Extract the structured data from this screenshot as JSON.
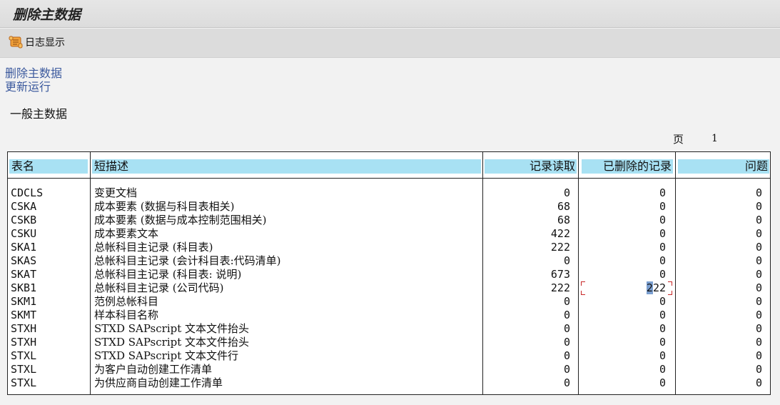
{
  "title": "删除主数据",
  "toolbar": {
    "log_button": "日志显示",
    "log_icon": "scroll-log-icon"
  },
  "links": {
    "delete": "删除主数据",
    "update": "更新运行"
  },
  "section_title": "一般主数据",
  "page": {
    "label": "页",
    "number": "1"
  },
  "table": {
    "headers": {
      "name": "表名",
      "desc": "短描述",
      "read": "记录读取",
      "deleted": "已删除的记录",
      "problem": "问题"
    },
    "rows": [
      {
        "name": "CDCLS",
        "desc": "变更文档",
        "read": "0",
        "deleted": "0",
        "problem": "0"
      },
      {
        "name": "CSKA",
        "desc": "成本要素 (数据与科目表相关)",
        "read": "68",
        "deleted": "0",
        "problem": "0"
      },
      {
        "name": "CSKB",
        "desc": "成本要素 (数据与成本控制范围相关)",
        "read": "68",
        "deleted": "0",
        "problem": "0"
      },
      {
        "name": "CSKU",
        "desc": "成本要素文本",
        "read": "422",
        "deleted": "0",
        "problem": "0"
      },
      {
        "name": "SKA1",
        "desc": "总帐科目主记录 (科目表)",
        "read": "222",
        "deleted": "0",
        "problem": "0"
      },
      {
        "name": "SKAS",
        "desc": "总帐科目主记录 (会计科目表:代码清单)",
        "read": "0",
        "deleted": "0",
        "problem": "0"
      },
      {
        "name": "SKAT",
        "desc": "总帐科目主记录 (科目表: 说明)",
        "read": "673",
        "deleted": "0",
        "problem": "0"
      },
      {
        "name": "SKB1",
        "desc": "总帐科目主记录 (公司代码)",
        "read": "222",
        "deleted": "222",
        "problem": "0"
      },
      {
        "name": "SKM1",
        "desc": "范例总帐科目",
        "read": "0",
        "deleted": "0",
        "problem": "0"
      },
      {
        "name": "SKMT",
        "desc": "样本科目名称",
        "read": "0",
        "deleted": "0",
        "problem": "0"
      },
      {
        "name": "STXH",
        "desc": "STXD SAPscript 文本文件抬头",
        "read": "0",
        "deleted": "0",
        "problem": "0"
      },
      {
        "name": "STXH",
        "desc": "STXD SAPscript 文本文件抬头",
        "read": "0",
        "deleted": "0",
        "problem": "0"
      },
      {
        "name": "STXL",
        "desc": "STXD SAPscript 文本文件行",
        "read": "0",
        "deleted": "0",
        "problem": "0"
      },
      {
        "name": "STXL",
        "desc": "为客户自动创建工作清单",
        "read": "0",
        "deleted": "0",
        "problem": "0"
      },
      {
        "name": "STXL",
        "desc": "为供应商自动创建工作清单",
        "read": "0",
        "deleted": "0",
        "problem": "0"
      }
    ]
  },
  "colors": {
    "header_bg": "#a8e1f3",
    "link": "#3c5a9e",
    "selection": "#c82828"
  }
}
